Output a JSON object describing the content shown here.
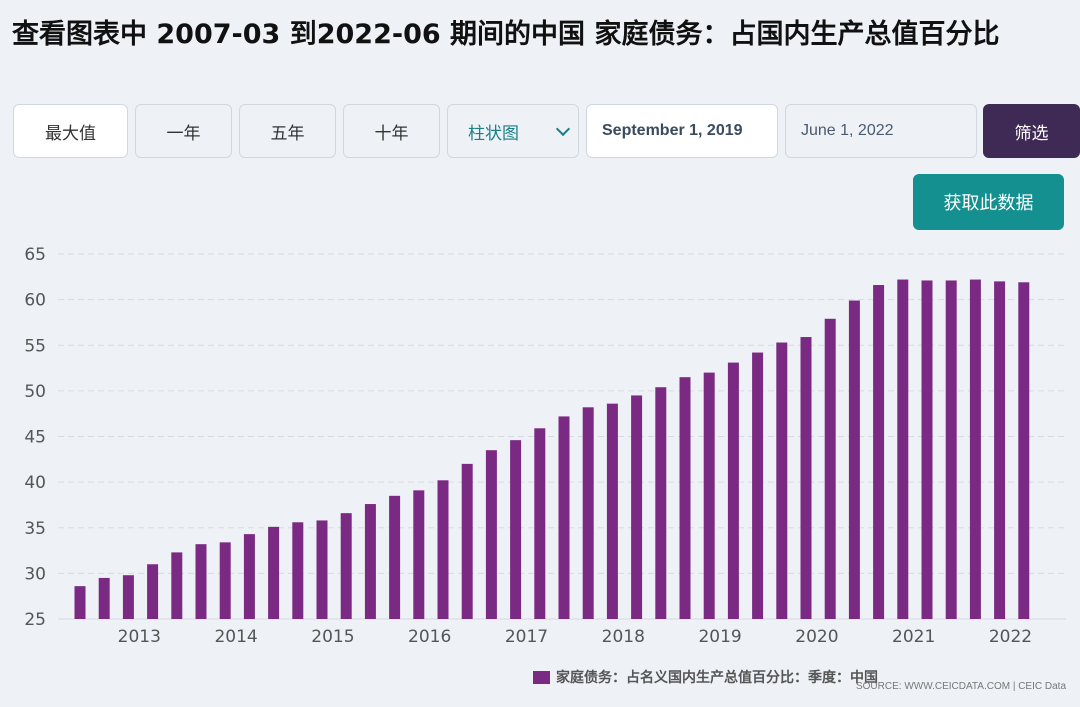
{
  "page": {
    "title": "查看图表中 2007-03 到2022-06 期间的中国 家庭债务：占国内生产总值百分比"
  },
  "toolbar": {
    "buttons": [
      "最大值",
      "一年",
      "五年",
      "十年"
    ],
    "chart_type_select": "柱状图",
    "start_date": "September 1, 2019",
    "end_date": "June 1, 2022",
    "filter_label": "筛选",
    "get_data_label": "获取此数据"
  },
  "colors": {
    "bar": "#7b2a83",
    "grid": "#d5dbe2",
    "filter_button": "#3f2a56",
    "get_data_button": "#13908f",
    "background": "#eef2f6"
  },
  "source": "SOURCE: WWW.CEICDATA.COM | CEIC Data",
  "chart_data": {
    "type": "bar",
    "title": "",
    "xlabel": "",
    "ylabel": "",
    "ylim": [
      25,
      65
    ],
    "y_ticks": [
      25,
      30,
      35,
      40,
      45,
      50,
      55,
      60,
      65
    ],
    "x_tick_labels": [
      "2013",
      "2014",
      "2015",
      "2016",
      "2017",
      "2018",
      "2019",
      "2020",
      "2021",
      "2022"
    ],
    "grid": true,
    "legend_position": "bottom-right",
    "series": [
      {
        "name": "家庭债务：占名义国内生产总值百分比：季度：中国",
        "color": "#7b2a83",
        "values": [
          28.6,
          29.5,
          29.8,
          31.0,
          32.3,
          33.2,
          33.4,
          34.3,
          35.1,
          35.6,
          35.8,
          36.6,
          37.6,
          38.5,
          39.1,
          40.2,
          42.0,
          43.5,
          44.6,
          45.9,
          47.2,
          48.2,
          48.6,
          49.5,
          50.4,
          51.5,
          52.0,
          53.1,
          54.2,
          55.3,
          55.9,
          57.9,
          59.9,
          61.6,
          62.2,
          62.1,
          62.1,
          62.2,
          62.0,
          61.9
        ]
      }
    ]
  }
}
